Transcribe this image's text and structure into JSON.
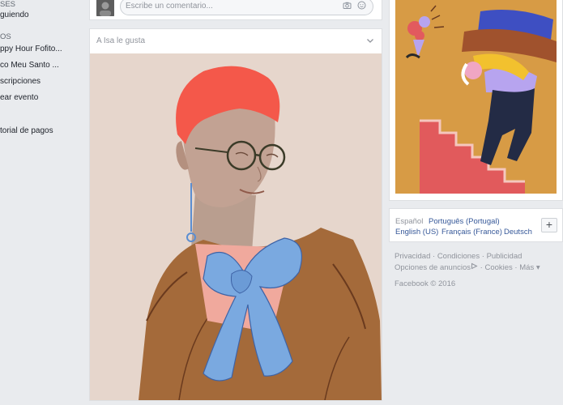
{
  "sidebar": {
    "items": [
      {
        "label": "SES"
      },
      {
        "label": "guiendo"
      },
      {
        "label": "OS"
      },
      {
        "label": "ppy Hour Fofito..."
      },
      {
        "label": "co Meu Santo ..."
      },
      {
        "label": "scripciones"
      },
      {
        "label": "ear evento"
      },
      {
        "label": ""
      },
      {
        "label": "torial de pagos"
      }
    ]
  },
  "feed": {
    "comment_placeholder": "Escribe un comentario...",
    "post_header": "A Isa          le gusta"
  },
  "languages": {
    "current": "Español",
    "options": [
      "Português (Portugal)",
      "English (US)",
      "Français (France)",
      "Deutsch"
    ],
    "add_label": "+"
  },
  "footer": {
    "links1": [
      "Privacidad",
      "Condiciones",
      "Publicidad"
    ],
    "ad_choices": "Opciones de anuncios",
    "links2": [
      "Cookies",
      "Más"
    ],
    "copyright": "Facebook © 2016"
  },
  "icons": {
    "camera": "camera-icon",
    "emoji": "emoji-icon",
    "chevron": "chevron-down-icon",
    "adchoices": "adchoices-icon"
  },
  "colors": {
    "link": "#365899",
    "background": "#e9ebee",
    "muted": "#90949c"
  }
}
